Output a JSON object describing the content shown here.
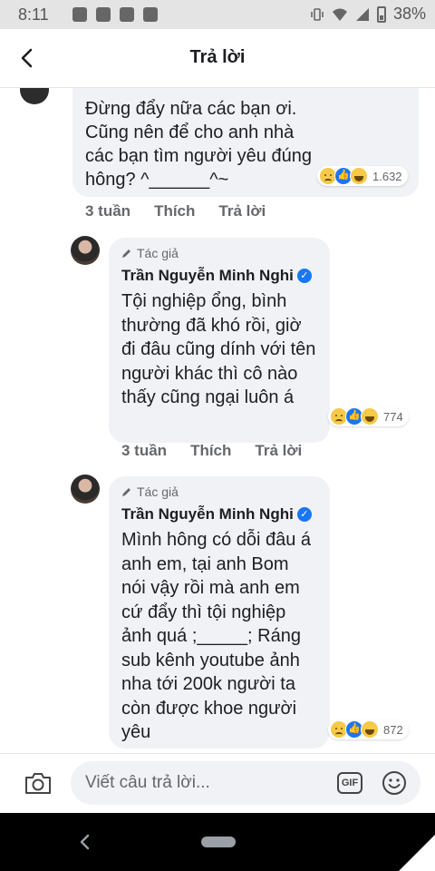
{
  "status_bar": {
    "time": "8:11",
    "battery": "38%"
  },
  "header": {
    "title": "Trả lời"
  },
  "comments": [
    {
      "text": "Đừng đẩy nữa các bạn ơi. Cũng nên để cho anh nhà các bạn tìm người yêu đúng hông? ^______^~",
      "reaction_count": "1.632",
      "time": "3 tuần",
      "like_label": "Thích",
      "reply_label": "Trả lời"
    },
    {
      "author_tag": "Tác giả",
      "author": "Trần Nguyễn Minh Nghi",
      "text": "Tội nghiệp ổng, bình thường đã khó rồi, giờ đi đâu cũng dính với tên người khác thì cô nào thấy cũng ngại luôn á",
      "reaction_count": "774",
      "time": "3 tuần",
      "like_label": "Thích",
      "reply_label": "Trả lời"
    },
    {
      "author_tag": "Tác giả",
      "author": "Trần Nguyễn Minh Nghi",
      "text": "Mình hông có dỗi đâu á anh em, tại anh Bom nói vậy rồi mà anh em cứ đẩy thì tội nghiệp ảnh quá ;_____; Ráng sub kênh youtube ảnh nha tới 200k người ta còn được khoe người yêu",
      "reaction_count": "872"
    }
  ],
  "reply_bar": {
    "placeholder": "Viết câu trả lời...",
    "gif_label": "GIF"
  },
  "colors": {
    "accent": "#1877f2",
    "bubble": "#f0f2f5",
    "meta_text": "#65676b"
  },
  "icons": [
    "back-arrow-icon",
    "pencil-icon",
    "verified-icon",
    "camera-icon",
    "gif-icon",
    "emoji-icon",
    "sad-reaction-icon",
    "like-reaction-icon",
    "haha-reaction-icon"
  ]
}
